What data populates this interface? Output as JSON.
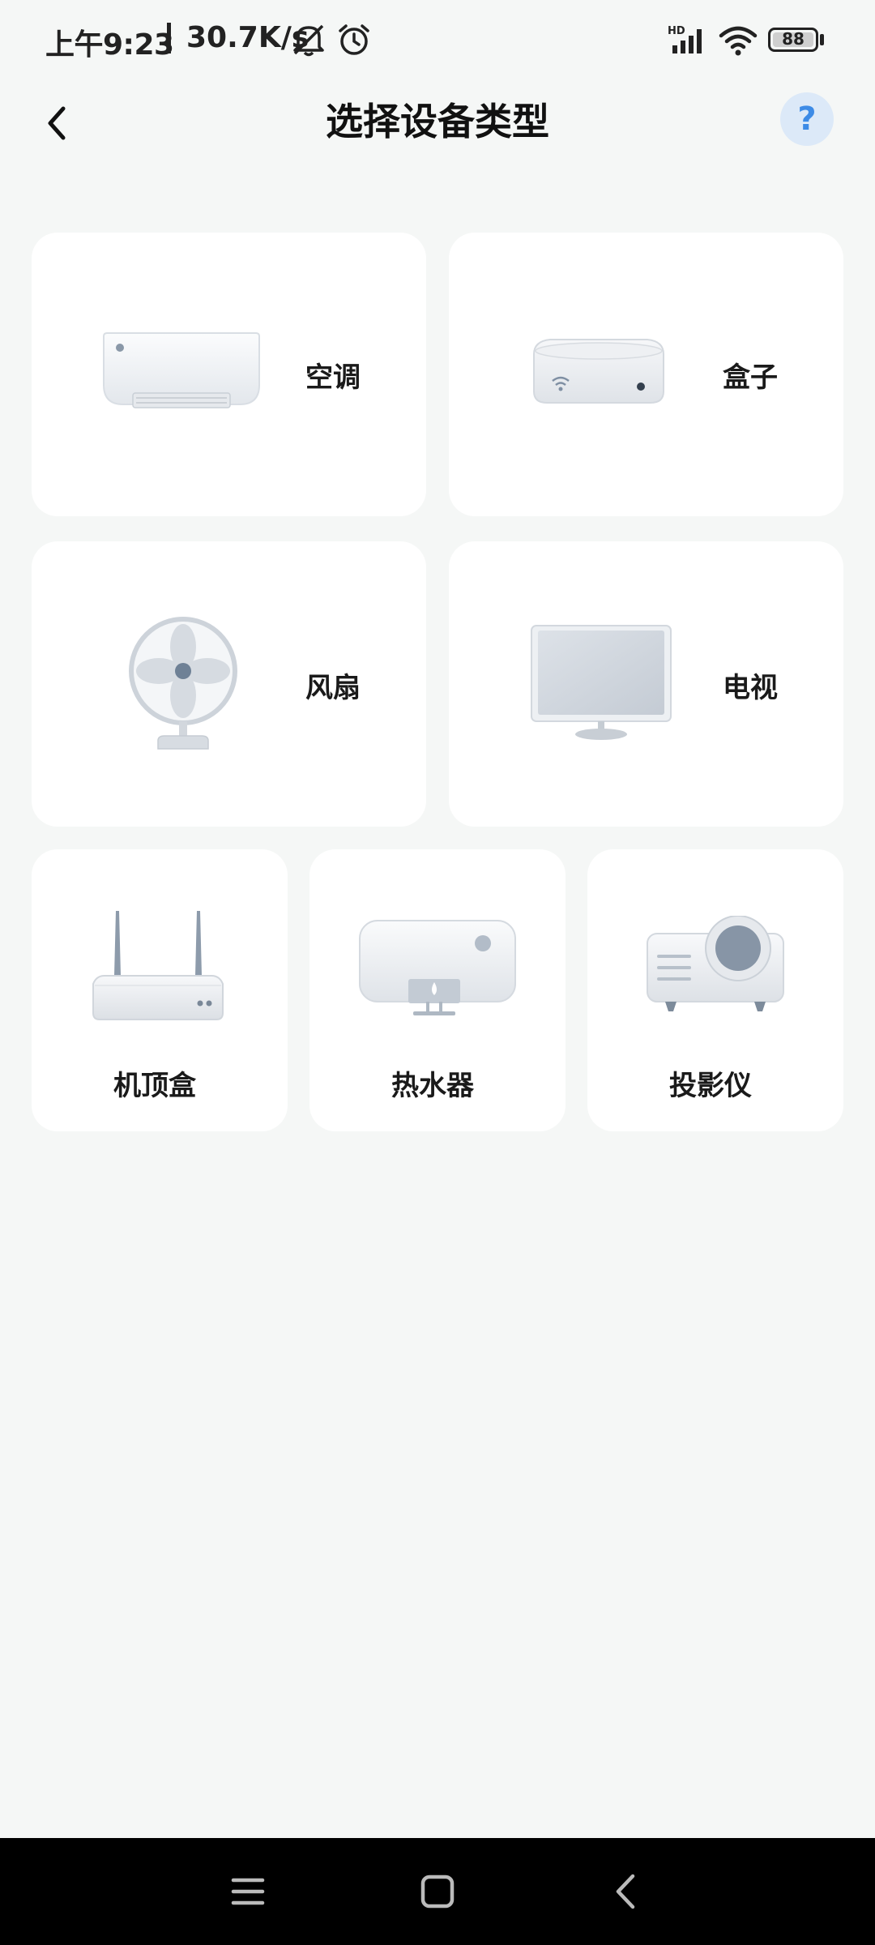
{
  "status_bar": {
    "time": "上午9:23",
    "net_speed": "30.7K/s",
    "battery": "88",
    "icons": [
      "mute-icon",
      "alarm-icon",
      "hd-signal-icon",
      "wifi-icon",
      "battery-icon"
    ]
  },
  "header": {
    "title": "选择设备类型",
    "back_icon": "chevron-left-icon",
    "help_label": "?"
  },
  "devices": [
    {
      "label": "空调",
      "icon": "air-conditioner-icon"
    },
    {
      "label": "盒子",
      "icon": "box-icon"
    },
    {
      "label": "风扇",
      "icon": "fan-icon"
    },
    {
      "label": "电视",
      "icon": "tv-icon"
    },
    {
      "label": "机顶盒",
      "icon": "set-top-box-icon"
    },
    {
      "label": "热水器",
      "icon": "water-heater-icon"
    },
    {
      "label": "投影仪",
      "icon": "projector-icon"
    }
  ],
  "nav_bar": {
    "icons": [
      "menu-icon",
      "home-icon",
      "back-icon"
    ]
  },
  "colors": {
    "background": "#f5f7f6",
    "card": "#ffffff",
    "help_bg": "#dce9f8",
    "help_fg": "#3d8be6"
  }
}
